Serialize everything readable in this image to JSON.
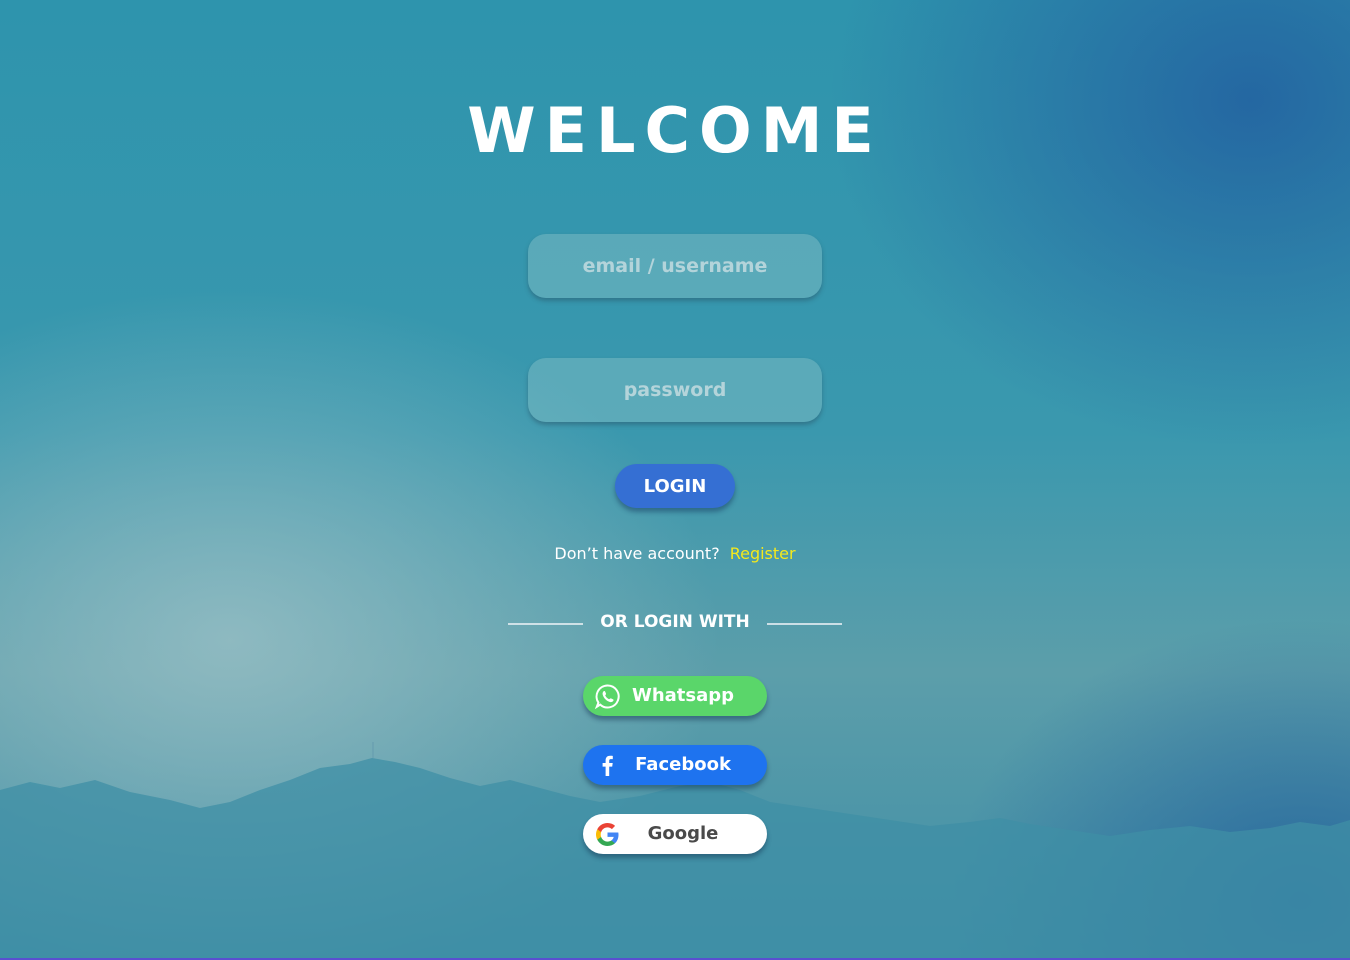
{
  "page": {
    "title": "WELCOME"
  },
  "form": {
    "email_placeholder": "email / username",
    "password_placeholder": "password",
    "login_label": "LOGIN"
  },
  "register": {
    "question": "Don’t have account?",
    "link_label": "Register"
  },
  "social": {
    "divider_text": "OR LOGIN WITH",
    "buttons": [
      {
        "label": "Whatsapp",
        "icon": "whatsapp-icon",
        "color": "#5ad66a"
      },
      {
        "label": "Facebook",
        "icon": "facebook-icon",
        "color": "#1e73ef"
      },
      {
        "label": "Google",
        "icon": "google-icon",
        "color": "#ffffff"
      }
    ]
  },
  "colors": {
    "accent_button": "#356fd3",
    "register_link": "#f4e91c",
    "background": "#3f91aa"
  }
}
